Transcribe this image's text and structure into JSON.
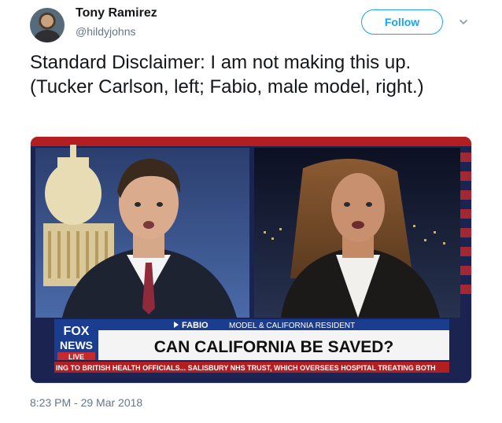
{
  "tweet": {
    "author_name": "Tony Ramirez",
    "author_handle": "@hildyjohns",
    "follow_label": "Follow",
    "text": "Standard Disclaimer: I am not making this up. (Tucker Carlson, left; Fabio, male model, right.)",
    "timestamp": "8:23 PM - 29 Mar 2018"
  },
  "media": {
    "lower_third_name": "FABIO",
    "lower_third_title": "MODEL & CALIFORNIA RESIDENT",
    "headline": "CAN CALIFORNIA BE SAVED?",
    "ticker": "ING TO BRITISH HEALTH OFFICIALS...   SALISBURY NHS TRUST, WHICH OVERSEES HOSPITAL TREATING BOTH",
    "logo_top": "FOX",
    "logo_bottom": "NEWS",
    "live_label": "LIVE"
  },
  "icons": [
    "avatar",
    "chevron-down-icon"
  ],
  "colors": {
    "accent": "#1da1f2",
    "text": "#14171a",
    "muted": "#657786",
    "fox_blue": "#1a3d8f",
    "banner_red": "#b31e23"
  }
}
